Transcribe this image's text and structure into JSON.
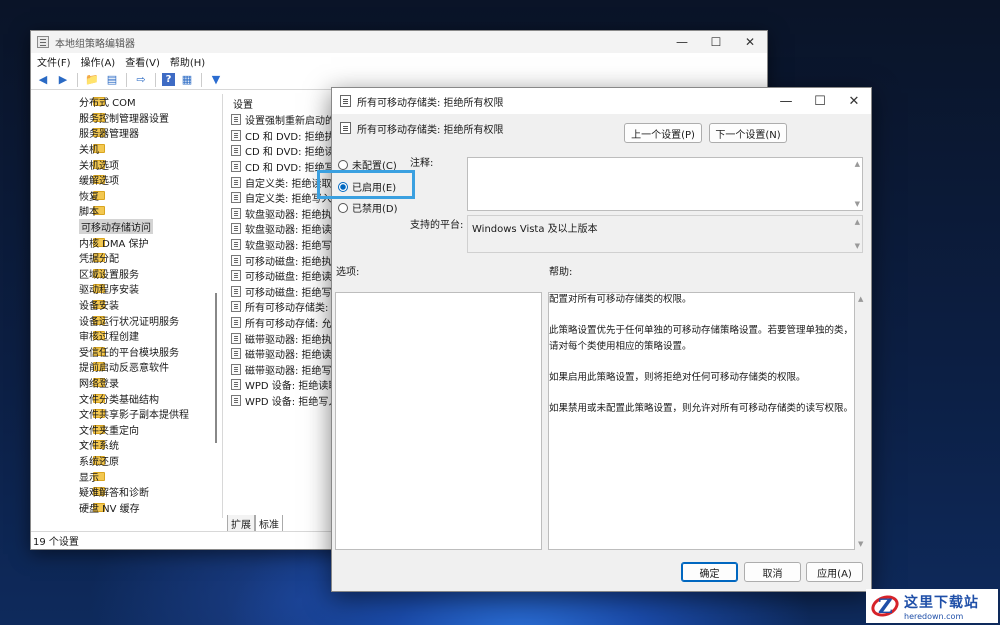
{
  "main_window": {
    "title": "本地组策略编辑器",
    "menu": [
      "文件(F)",
      "操作(A)",
      "查看(V)",
      "帮助(H)"
    ],
    "tree_items": [
      {
        "label": "分布式 COM",
        "expandable": true
      },
      {
        "label": "服务控制管理器设置",
        "expandable": true
      },
      {
        "label": "服务器管理器",
        "expandable": false
      },
      {
        "label": "关机",
        "expandable": false
      },
      {
        "label": "关机选项",
        "expandable": false
      },
      {
        "label": "缓解选项",
        "expandable": false
      },
      {
        "label": "恢复",
        "expandable": false
      },
      {
        "label": "脚本",
        "expandable": false
      },
      {
        "label": "可移动存储访问",
        "expandable": false,
        "selected": true
      },
      {
        "label": "内核 DMA 保护",
        "expandable": false
      },
      {
        "label": "凭据分配",
        "expandable": false
      },
      {
        "label": "区域设置服务",
        "expandable": false
      },
      {
        "label": "驱动程序安装",
        "expandable": false
      },
      {
        "label": "设备安装",
        "expandable": true
      },
      {
        "label": "设备运行状况证明服务",
        "expandable": false
      },
      {
        "label": "审核过程创建",
        "expandable": false
      },
      {
        "label": "受信任的平台模块服务",
        "expandable": false
      },
      {
        "label": "提前启动反恶意软件",
        "expandable": false
      },
      {
        "label": "网络登录",
        "expandable": true
      },
      {
        "label": "文件分类基础结构",
        "expandable": false
      },
      {
        "label": "文件共享影子副本提供程",
        "expandable": false
      },
      {
        "label": "文件夹重定向",
        "expandable": false
      },
      {
        "label": "文件系统",
        "expandable": true
      },
      {
        "label": "系统还原",
        "expandable": false
      },
      {
        "label": "显示",
        "expandable": false
      },
      {
        "label": "疑难解答和诊断",
        "expandable": true
      },
      {
        "label": "硬盘 NV 缓存",
        "expandable": false
      }
    ],
    "list_header": "设置",
    "list_items": [
      "设置强制重新启动的",
      "CD 和 DVD: 拒绝执行",
      "CD 和 DVD: 拒绝读取",
      "CD 和 DVD: 拒绝写入",
      "自定义类: 拒绝读取权",
      "自定义类: 拒绝写入权",
      "软盘驱动器: 拒绝执行",
      "软盘驱动器: 拒绝读取",
      "软盘驱动器: 拒绝写入",
      "可移动磁盘: 拒绝执行",
      "可移动磁盘: 拒绝读取",
      "可移动磁盘: 拒绝写入",
      "所有可移动存储类: 拒",
      "所有可移动存储: 允许",
      "磁带驱动器: 拒绝执行",
      "磁带驱动器: 拒绝读取",
      "磁带驱动器: 拒绝写入",
      "WPD 设备: 拒绝读取",
      "WPD 设备: 拒绝写入"
    ],
    "tabs": [
      "扩展",
      "标准"
    ],
    "status": "19 个设置"
  },
  "dialog": {
    "title": "所有可移动存储类: 拒绝所有权限",
    "subtitle": "所有可移动存储类: 拒绝所有权限",
    "prev_button": "上一个设置(P)",
    "next_button": "下一个设置(N)",
    "radio_not_configured": "未配置(C)",
    "radio_enabled": "已启用(E)",
    "radio_disabled": "已禁用(D)",
    "selected_option": "已启用(E)",
    "comment_label": "注释:",
    "comment_value": "",
    "platform_label": "支持的平台:",
    "platform_value": "Windows Vista 及以上版本",
    "options_label": "选项:",
    "help_label": "帮助:",
    "help_paragraphs": [
      "配置对所有可移动存储类的权限。",
      "此策略设置优先于任何单独的可移动存储策略设置。若要管理单独的类，请对每个类使用相应的策略设置。",
      "如果启用此策略设置，则将拒绝对任何可移动存储类的权限。",
      "如果禁用或未配置此策略设置，则允许对所有可移动存储类的读写权限。"
    ],
    "ok_button": "确定",
    "cancel_button": "取消",
    "apply_button": "应用(A)"
  },
  "watermark": {
    "text_cn": "这里下载站",
    "text_en": "heredown.com",
    "logo_letter": "Z"
  },
  "colors": {
    "accent": "#0067c0",
    "highlight_box": "#3aa0e0",
    "folder": "#f3c851"
  }
}
